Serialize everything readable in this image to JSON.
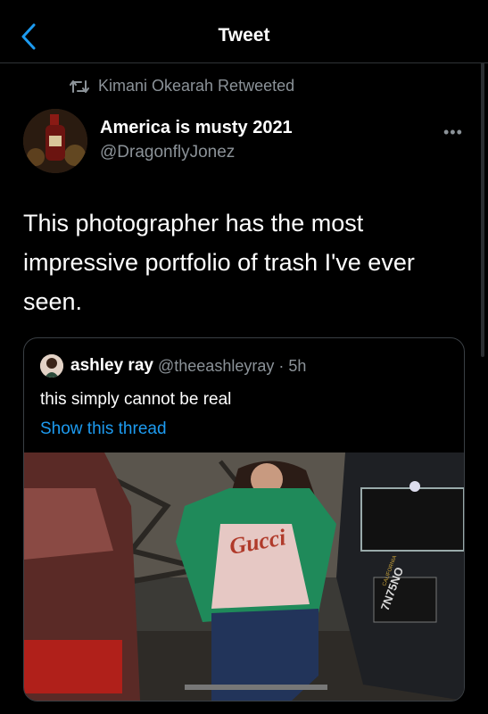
{
  "nav": {
    "title": "Tweet"
  },
  "retweet": {
    "text": "Kimani Okearah Retweeted"
  },
  "tweet": {
    "name": "America is musty 2021",
    "handle": "@DragonflyJonez",
    "text": "This photographer has the most impressive portfolio of trash I've ever seen."
  },
  "quote": {
    "name": "ashley ray",
    "handle": "@theeashleyray · 5h",
    "text": "this simply cannot be real",
    "link": "Show this thread",
    "media": {
      "jacket_text": "Gucci",
      "plate_state": "CALIFORNIA",
      "plate_number": "7N75NO"
    }
  },
  "colors": {
    "link": "#1d9bf0",
    "muted": "#8b9298",
    "border": "#2f3336"
  },
  "icons": [
    "chevron-left-icon",
    "retweet-icon",
    "more-icon"
  ]
}
